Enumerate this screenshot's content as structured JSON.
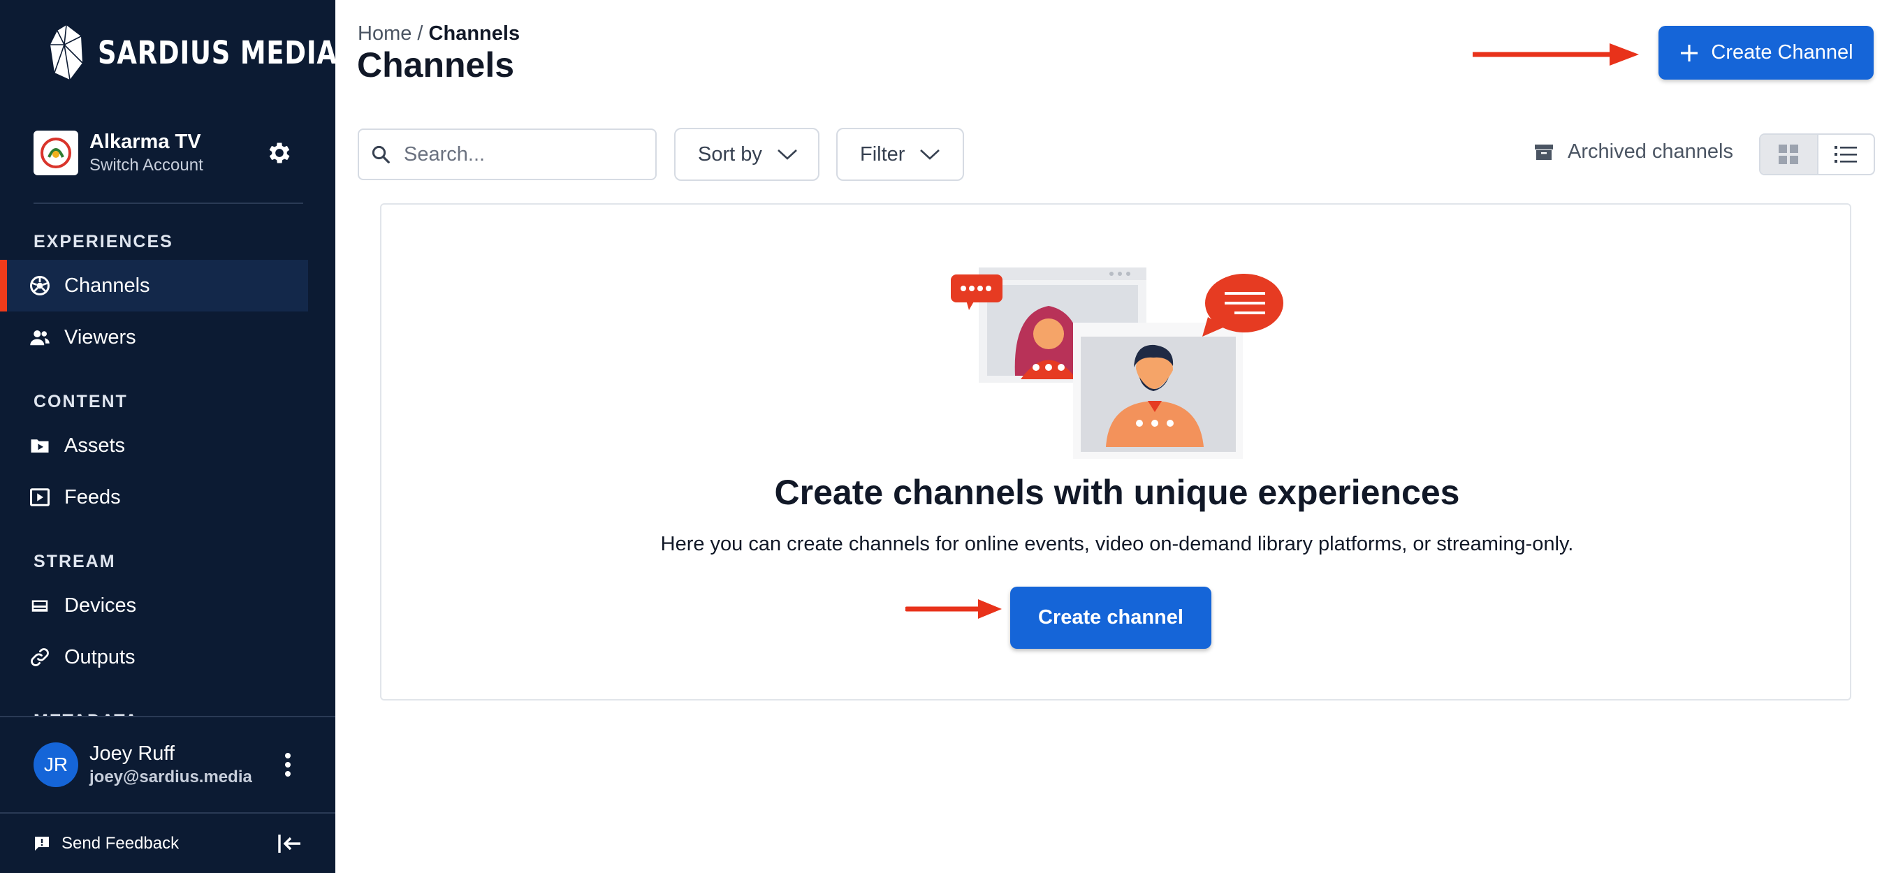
{
  "brand": {
    "name": "SARDIUS MEDIA",
    "trademark": "®"
  },
  "account": {
    "name": "Alkarma TV",
    "switch_label": "Switch Account"
  },
  "sidebar": {
    "sections": [
      {
        "label": "EXPERIENCES",
        "items": [
          {
            "label": "Channels",
            "icon": "channels-icon",
            "active": true
          },
          {
            "label": "Viewers",
            "icon": "users-icon"
          }
        ]
      },
      {
        "label": "CONTENT",
        "items": [
          {
            "label": "Assets",
            "icon": "folder-play-icon"
          },
          {
            "label": "Feeds",
            "icon": "feed-icon"
          }
        ]
      },
      {
        "label": "STREAM",
        "items": [
          {
            "label": "Devices",
            "icon": "device-icon"
          },
          {
            "label": "Outputs",
            "icon": "link-icon"
          }
        ]
      },
      {
        "label": "METADATA"
      }
    ]
  },
  "user": {
    "initials": "JR",
    "name": "Joey Ruff",
    "email": "joey@sardius.media"
  },
  "footer": {
    "feedback_label": "Send Feedback"
  },
  "breadcrumb": {
    "home": "Home",
    "separator": "/",
    "current": "Channels"
  },
  "page": {
    "title": "Channels"
  },
  "header": {
    "create_button_label": "Create Channel"
  },
  "toolbar": {
    "search_placeholder": "Search...",
    "sort_label": "Sort by",
    "filter_label": "Filter",
    "archived_label": "Archived channels",
    "view_mode": "grid"
  },
  "empty_state": {
    "title": "Create channels with unique experiences",
    "description": "Here you can create channels for online events, video on-demand library platforms, or streaming-only.",
    "button_label": "Create channel"
  },
  "colors": {
    "sidebar_bg": "#0c1b33",
    "primary": "#1565d8",
    "accent": "#ef3b1b",
    "arrow": "#e8321a"
  }
}
